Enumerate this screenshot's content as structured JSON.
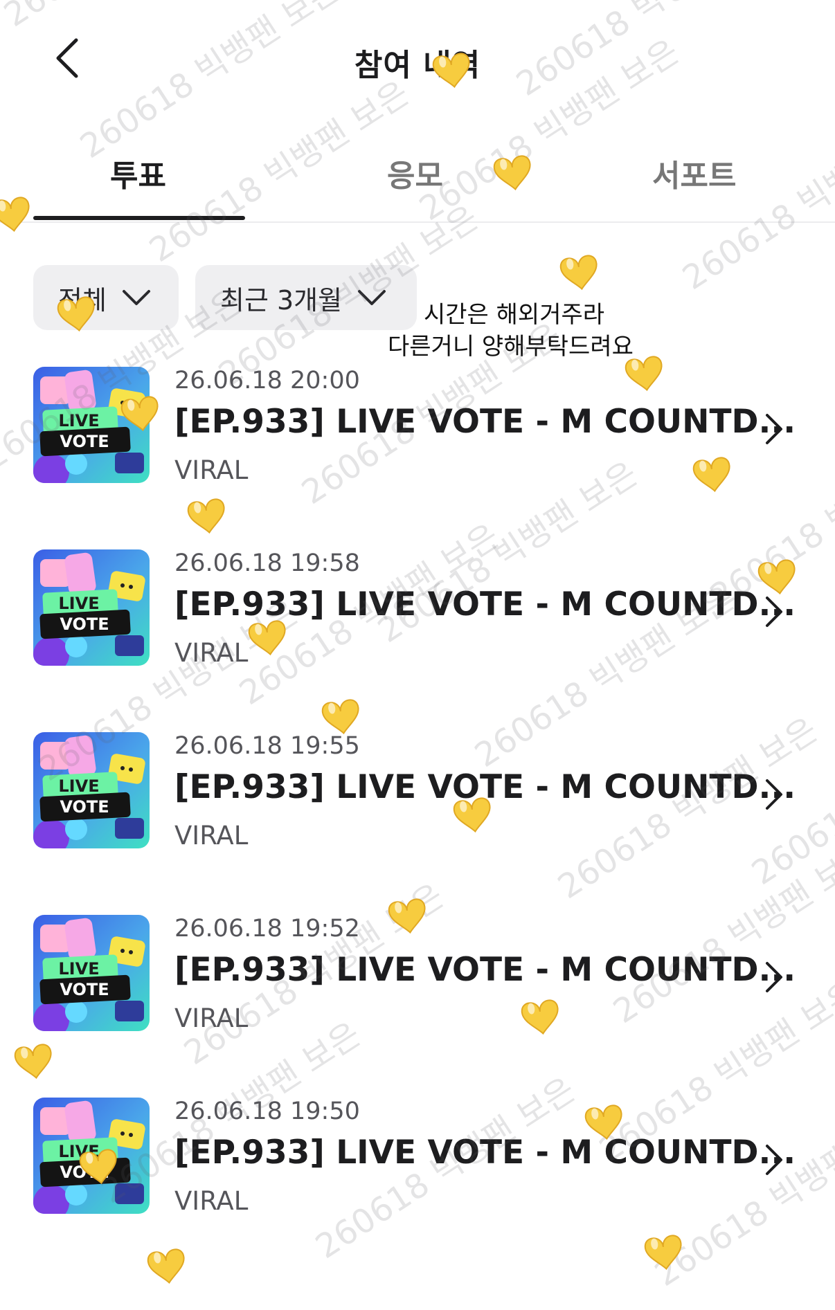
{
  "header": {
    "title": "참여 내역"
  },
  "tabs": [
    {
      "label": "투표"
    },
    {
      "label": "응모"
    },
    {
      "label": "서포트"
    }
  ],
  "filters": {
    "category": {
      "label": "전체"
    },
    "period": {
      "label": "최근 3개월"
    }
  },
  "note": {
    "line1": "시간은 해외거주라",
    "line2": "다른거니 양해부탁드려요"
  },
  "items": [
    {
      "time": "26.06.18 20:00",
      "title": "[EP.933] LIVE VOTE - M COUNTD...",
      "sub": "VIRAL"
    },
    {
      "time": "26.06.18 19:58",
      "title": "[EP.933] LIVE VOTE - M COUNTD...",
      "sub": "VIRAL"
    },
    {
      "time": "26.06.18 19:55",
      "title": "[EP.933] LIVE VOTE - M COUNTD...",
      "sub": "VIRAL"
    },
    {
      "time": "26.06.18 19:52",
      "title": "[EP.933] LIVE VOTE - M COUNTD...",
      "sub": "VIRAL"
    },
    {
      "time": "26.06.18 19:50",
      "title": "[EP.933] LIVE VOTE - M COUNTD...",
      "sub": "VIRAL"
    }
  ],
  "thumbnail": {
    "line1": "LIVE",
    "line2": "VOTE"
  },
  "watermark": {
    "text": "260618 빅뱅팬 보은"
  },
  "colors": {
    "heart": "#f7cc3f",
    "thumb_bg_top": "#3f6fe8",
    "thumb_bg_bottom": "#3fd7c6",
    "vote_badge": "#6cf2a4"
  },
  "icons": {
    "back": "chevron-left-icon",
    "dropdown": "chevron-down-icon",
    "row_arrow": "chevron-right-icon",
    "sticker": "heart-icon"
  }
}
